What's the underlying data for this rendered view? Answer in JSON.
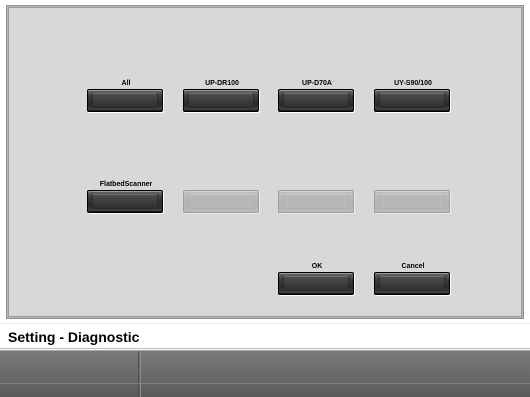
{
  "dialog": {
    "buttons": [
      {
        "label": "All",
        "enabled": true
      },
      {
        "label": "UP-DR100",
        "enabled": true
      },
      {
        "label": "UP-D70A",
        "enabled": true
      },
      {
        "label": "UY-S90/100",
        "enabled": true
      },
      {
        "label": "FlatbedScanner",
        "enabled": true
      },
      {
        "label": "",
        "enabled": false
      },
      {
        "label": "",
        "enabled": false
      },
      {
        "label": "",
        "enabled": false
      }
    ],
    "ok_label": "OK",
    "cancel_label": "Cancel"
  },
  "status": {
    "title": "Setting - Diagnostic"
  },
  "colors": {
    "panel_background": "#d8d8d8",
    "button_dark": "#2f2f2f",
    "button_disabled": "#b7b7b7",
    "bottom_bar": "#696969"
  }
}
